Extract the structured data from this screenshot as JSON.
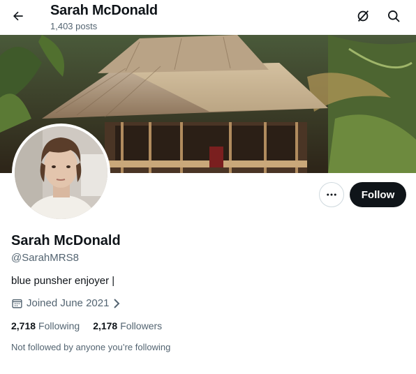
{
  "header": {
    "name": "Sarah McDonald",
    "posts": "1,403 posts",
    "icons": {
      "back": "arrow-left-icon",
      "grok": "grok-icon",
      "search": "search-icon"
    }
  },
  "banner": {
    "description": "thatched bamboo hut in jungle"
  },
  "profile": {
    "display_name": "Sarah McDonald",
    "handle": "@SarahMRS8",
    "bio": "blue punsher enjoyer |",
    "joined": "Joined June 2021",
    "following_count": "2,718",
    "following_label": "Following",
    "followers_count": "2,178",
    "followers_label": "Followers",
    "not_followed": "Not followed by anyone you’re following"
  },
  "actions": {
    "follow_label": "Follow",
    "more_icon": "more-dots-icon"
  },
  "colors": {
    "primary_text": "#0f1419",
    "secondary_text": "#536471",
    "border": "#cfd9de"
  }
}
